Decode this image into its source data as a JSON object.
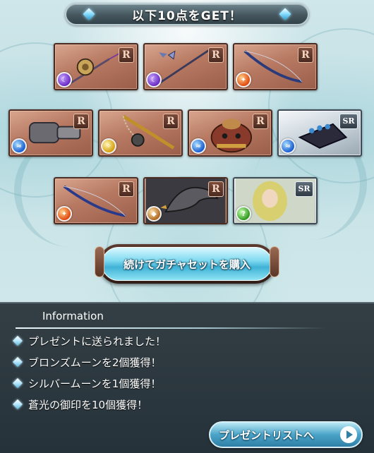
{
  "header": {
    "title": "以下10点をGET！"
  },
  "items": [
    {
      "rarity": "R",
      "element": "dark",
      "weapon": "mace"
    },
    {
      "rarity": "R",
      "element": "dark",
      "weapon": "staff"
    },
    {
      "rarity": "R",
      "element": "fire",
      "weapon": "bow"
    },
    {
      "rarity": "R",
      "element": "water",
      "weapon": "gauntlet"
    },
    {
      "rarity": "R",
      "element": "light",
      "weapon": "flail"
    },
    {
      "rarity": "R",
      "element": "water",
      "weapon": "bag"
    },
    {
      "rarity": "SR",
      "element": "water",
      "weapon": "claw"
    },
    {
      "rarity": "R",
      "element": "fire",
      "weapon": "bow"
    },
    {
      "rarity": "R",
      "element": "earth",
      "weapon": "eagle-summon"
    },
    {
      "rarity": "SR",
      "element": "wind",
      "weapon": "character-summon"
    }
  ],
  "actions": {
    "continue_label": "続けてガチャセットを購入"
  },
  "info": {
    "title": "Information",
    "messages": [
      "プレゼントに送られました！",
      "ブロンズムーンを2個獲得！",
      "シルバームーンを1個獲得！",
      "蒼光の御印を10個獲得！"
    ],
    "present_list_label": "プレゼントリストへ"
  },
  "colors": {
    "card_r": "#b77962",
    "card_sr": "#c9d3db",
    "button_cyan": "#4aa4c8",
    "panel_dark": "#2b373d"
  }
}
